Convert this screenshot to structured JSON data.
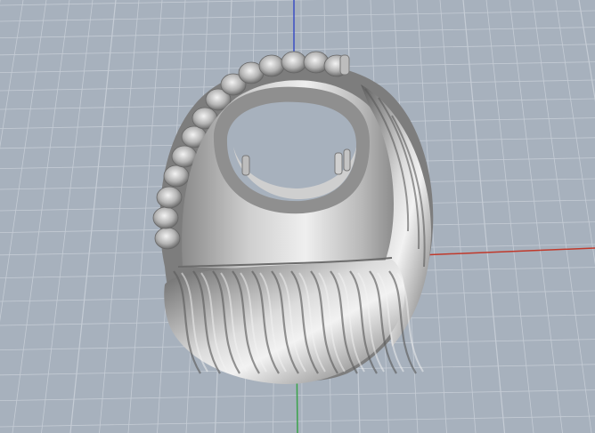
{
  "viewport": {
    "view_type": "perspective",
    "model": "signet-ring-with-twisted-rope-shank",
    "background_color": "#a7b1bd",
    "grid_color": "#c5ccd5",
    "grid_major_color": "#b9c1cb",
    "axis_x_color": "#c0392b",
    "axis_y_color": "#3aa34a",
    "axis_z_color": "#3b4fc4",
    "metal_color": "#a9a9a9",
    "metal_highlight": "#e6e6e6",
    "metal_shadow": "#555555"
  }
}
